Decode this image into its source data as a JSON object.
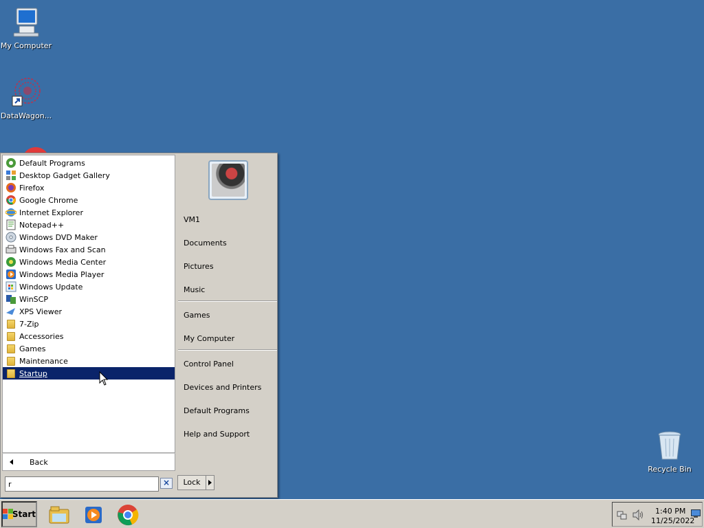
{
  "desktop": {
    "icons": [
      {
        "label": "My Computer",
        "icon": "computer-icon"
      },
      {
        "label": "DataWagon...",
        "icon": "datawagon-shortcut-icon"
      },
      {
        "label": "Recycle Bin",
        "icon": "recycle-bin-icon"
      }
    ]
  },
  "start_menu": {
    "programs": [
      {
        "label": "Default Programs",
        "icon": "default-programs-icon"
      },
      {
        "label": "Desktop Gadget Gallery",
        "icon": "gadget-gallery-icon"
      },
      {
        "label": "Firefox",
        "icon": "firefox-icon"
      },
      {
        "label": "Google Chrome",
        "icon": "chrome-icon"
      },
      {
        "label": "Internet Explorer",
        "icon": "internet-explorer-icon"
      },
      {
        "label": "Notepad++",
        "icon": "notepad-plus-plus-icon"
      },
      {
        "label": "Windows DVD Maker",
        "icon": "dvd-maker-icon"
      },
      {
        "label": "Windows Fax and Scan",
        "icon": "fax-scan-icon"
      },
      {
        "label": "Windows Media Center",
        "icon": "media-center-icon"
      },
      {
        "label": "Windows Media Player",
        "icon": "media-player-icon"
      },
      {
        "label": "Windows Update",
        "icon": "windows-update-icon"
      },
      {
        "label": "WinSCP",
        "icon": "winscp-icon"
      },
      {
        "label": "XPS Viewer",
        "icon": "xps-viewer-icon"
      },
      {
        "label": "7-Zip",
        "icon": "folder-icon"
      },
      {
        "label": "Accessories",
        "icon": "folder-icon"
      },
      {
        "label": "Games",
        "icon": "folder-icon"
      },
      {
        "label": "Maintenance",
        "icon": "folder-icon"
      },
      {
        "label": "Startup",
        "icon": "folder-icon",
        "selected": true
      }
    ],
    "back_label": "Back",
    "search_value": "r",
    "right_items": {
      "user": "VM1",
      "documents": "Documents",
      "pictures": "Pictures",
      "music": "Music",
      "games": "Games",
      "my_computer": "My Computer",
      "control_panel": "Control Panel",
      "devices_printers": "Devices and Printers",
      "default_programs": "Default Programs",
      "help_support": "Help and Support"
    },
    "lock_label": "Lock"
  },
  "taskbar": {
    "start_label": "Start",
    "apps": [
      "explorer-icon",
      "media-player-icon",
      "chrome-icon"
    ],
    "clock_time": "1:40 PM",
    "clock_date": "11/25/2022"
  },
  "colors": {
    "desktop": "#3a6ea5",
    "selection": "#0a246a",
    "menu_bg": "#d4d0c8"
  }
}
